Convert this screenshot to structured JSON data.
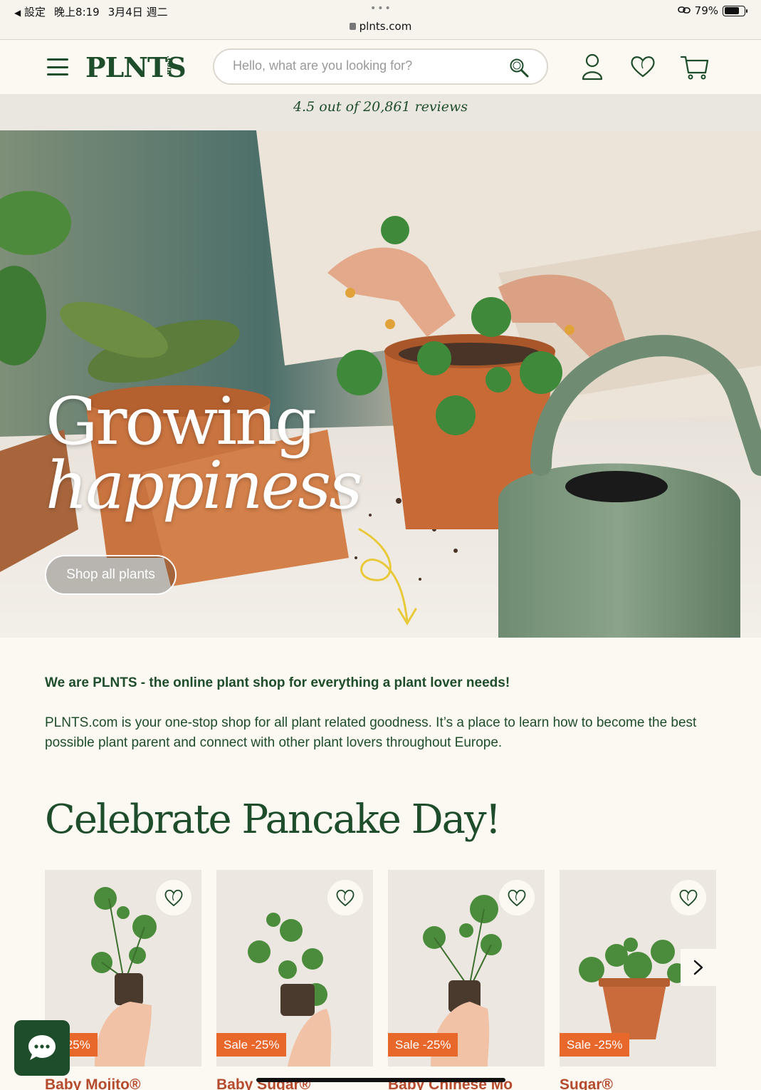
{
  "status_bar": {
    "back_label": "設定",
    "time": "晚上8:19",
    "date": "3月4日 週二",
    "url": "plnts.com",
    "battery": "79%"
  },
  "header": {
    "logo": "PLNTS",
    "logo_suffix": ".com",
    "search_placeholder": "Hello, what are you looking for?"
  },
  "reviews_text": "4.5 out of 20,861 reviews",
  "hero": {
    "title_line1": "Growing",
    "title_line2": "happiness",
    "cta_label": "Shop all plants"
  },
  "intro": {
    "title": "We are PLNTS - the online plant shop for everything a plant lover needs!",
    "text": "PLNTS.com is your one-stop shop for all plant related goodness. It’s a place to learn how to become the best possible plant parent and connect with other plant lovers throughout Europe."
  },
  "section_title": "Celebrate Pancake Day!",
  "products": [
    {
      "name": "Baby Mojito®",
      "sale": "e -25%"
    },
    {
      "name": "Baby Sugar®",
      "sale": "Sale -25%"
    },
    {
      "name": "Baby Chinese Mo",
      "sale": "Sale -25%"
    },
    {
      "name": "Sugar®",
      "sale": "Sale -25%"
    }
  ],
  "colors": {
    "brand_green": "#1e4d2b",
    "sale_orange": "#e8672b",
    "product_name": "#b54a2c",
    "background": "#fcf9f3"
  },
  "icons": {
    "menu": "hamburger-icon",
    "search": "search-icon",
    "account": "user-icon",
    "wishlist": "heart-icon",
    "cart": "cart-icon",
    "chat": "chat-icon",
    "carousel_next": "chevron-right-icon"
  }
}
